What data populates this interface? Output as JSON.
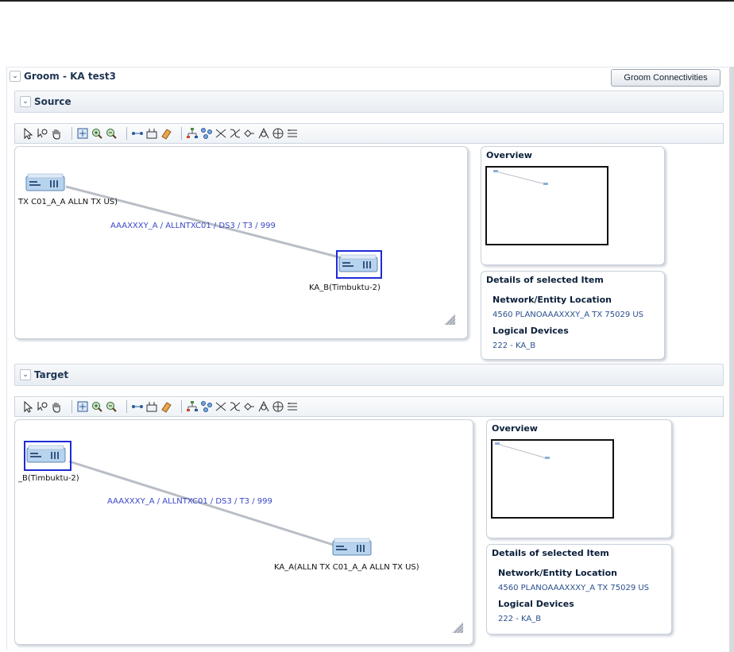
{
  "groom": {
    "title": "Groom - KA test3",
    "connectivities_button": "Groom Connectivities"
  },
  "source": {
    "header": "Source",
    "node_a": "TX C01_A_A ALLN TX  US)",
    "node_b": "KA_B(Timbuktu-2)",
    "edge_label": "AAAXXXY_A / ALLNTXC01 / DS3 / T3 / 999",
    "selected_node": "KA_B",
    "overview": {
      "title": "Overview"
    },
    "details": {
      "title": "Details of selected Item",
      "location_label": "Network/Entity Location",
      "location_value": "4560 PLANOAAAXXXY_A TX 75029 US",
      "devices_label": "Logical Devices",
      "devices_value": "222 - KA_B"
    }
  },
  "target": {
    "header": "Target",
    "node_a": "_B(Timbuktu-2)",
    "node_b": "KA_A(ALLN TX  C01_A_A ALLN TX  US)",
    "edge_label": "AAAXXXY_A / ALLNTXC01 / DS3 / T3 / 999",
    "selected_node": "KA_B",
    "overview": {
      "title": "Overview"
    },
    "details": {
      "title": "Details of selected Item",
      "location_label": "Network/Entity Location",
      "location_value": "4560 PLANOAAAXXXY_A TX 75029 US",
      "devices_label": "Logical Devices",
      "devices_value": "222 - KA_B"
    }
  },
  "toolbar_icons": [
    "select-arrow-icon",
    "zoom-select-icon",
    "pan-hand-icon",
    "fit-to-window-icon",
    "zoom-in-icon",
    "zoom-out-icon",
    "connect-link-icon",
    "layout-tree-icon",
    "clear-eraser-icon",
    "hierarchy-layout-icon",
    "network-layout-icon",
    "circular-layout-icon",
    "radial-layout-icon",
    "grid-layout-icon",
    "balloon-layout-icon",
    "orthogonal-layout-icon",
    "list-layout-icon"
  ],
  "colors": {
    "selection": "#1f2bd6",
    "edge": "#b9bec6",
    "link_text": "#3a47c8"
  }
}
